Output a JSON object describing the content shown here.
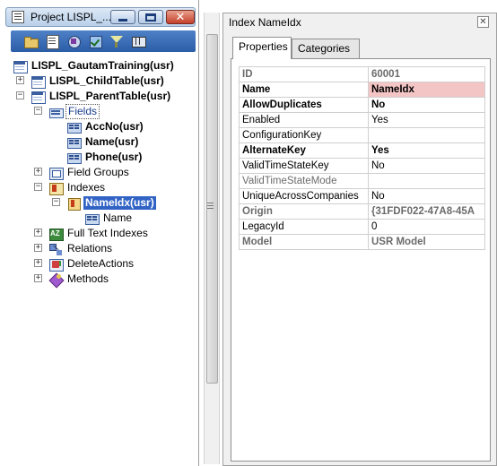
{
  "left_window": {
    "title": "Project LISPL_...",
    "buttons": {
      "minimize": "minimize",
      "maximize": "maximize",
      "close": "✕"
    }
  },
  "toolbar": {
    "icons": [
      "open-icon",
      "properties-icon",
      "compile-icon",
      "check-icon",
      "filter-icon",
      "grid-icon"
    ]
  },
  "tree": {
    "items": [
      {
        "label": "LISPL_GautamTraining(usr)",
        "icon": "project-table-icon"
      },
      {
        "label": "LISPL_ChildTable(usr)",
        "icon": "table-icon",
        "expander": "+"
      },
      {
        "label": "LISPL_ParentTable(usr)",
        "icon": "table-icon",
        "expander": "−"
      },
      {
        "label": "Fields",
        "icon": "fields-icon",
        "expander": "−"
      },
      {
        "label": "AccNo(usr)",
        "icon": "field-icon"
      },
      {
        "label": "Name(usr)",
        "icon": "field-icon"
      },
      {
        "label": "Phone(usr)",
        "icon": "field-icon"
      },
      {
        "label": "Field Groups",
        "icon": "field-groups-icon",
        "expander": "+"
      },
      {
        "label": "Indexes",
        "icon": "indexes-icon",
        "expander": "−"
      },
      {
        "label": "NameIdx(usr)",
        "icon": "index-icon",
        "expander": "−"
      },
      {
        "label": "Name",
        "icon": "field-icon"
      },
      {
        "label": "Full Text Indexes",
        "icon": "full-text-icon",
        "expander": "+"
      },
      {
        "label": "Relations",
        "icon": "relations-icon",
        "expander": "+"
      },
      {
        "label": "DeleteActions",
        "icon": "delete-actions-icon",
        "expander": "+"
      },
      {
        "label": "Methods",
        "icon": "methods-icon",
        "expander": "+"
      }
    ]
  },
  "right_window": {
    "title": "Index NameIdx",
    "close": "✕",
    "tabs": [
      "Properties",
      "Categories"
    ],
    "properties": [
      {
        "key": "ID",
        "value": "60001"
      },
      {
        "key": "Name",
        "value": "NameIdx"
      },
      {
        "key": "AllowDuplicates",
        "value": "No"
      },
      {
        "key": "Enabled",
        "value": "Yes"
      },
      {
        "key": "ConfigurationKey",
        "value": ""
      },
      {
        "key": "AlternateKey",
        "value": "Yes"
      },
      {
        "key": "ValidTimeStateKey",
        "value": "No"
      },
      {
        "key": "ValidTimeStateMode",
        "value": ""
      },
      {
        "key": "UniqueAcrossCompanies",
        "value": "No"
      },
      {
        "key": "Origin",
        "value": "{31FDF022-47A8-45A"
      },
      {
        "key": "LegacyId",
        "value": "0"
      },
      {
        "key": "Model",
        "value": "USR Model"
      }
    ]
  },
  "colors": {
    "selection": "#3163c5",
    "toolbar": "#2b5da8",
    "name_value_highlight": "#f4c5c5"
  }
}
